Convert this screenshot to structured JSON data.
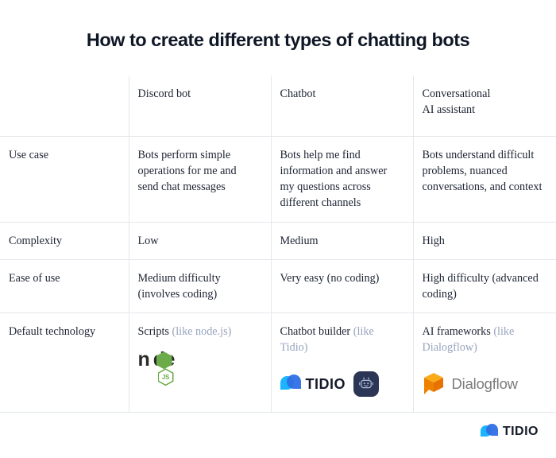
{
  "page": {
    "title": "How to create different types of chatting bots"
  },
  "table": {
    "headers": [
      "",
      "Discord bot",
      "Chatbot",
      "Conversational\nAI assistant"
    ],
    "header_col3_line1": "Conversational",
    "header_col3_line2": "AI assistant",
    "rows": [
      {
        "label": "Use case",
        "cells": [
          "Bots perform simple operations for me and send chat messages",
          "Bots help me find information and answer my questions across different channels",
          "Bots understand difficult problems, nuanced conversations, and context"
        ]
      },
      {
        "label": "Complexity",
        "cells": [
          "Low",
          "Medium",
          "High"
        ]
      },
      {
        "label": "Ease of use",
        "cells": [
          "Medium difficulty (involves coding)",
          "Very easy (no coding)",
          "High difficulty (advanced coding)"
        ]
      },
      {
        "label": "Default technology",
        "cells": [
          {
            "main": "Scripts ",
            "muted": "(like node.js)"
          },
          {
            "main": "Chatbot builder ",
            "muted": "(like Tidio)"
          },
          {
            "main": "AI frameworks ",
            "muted": "(like Dialogflow)"
          }
        ]
      }
    ]
  },
  "logos": {
    "node": {
      "wordmark": "n de",
      "badge_text": "JS",
      "name": "node.js"
    },
    "tidio": {
      "wordmark": "TIDIO",
      "name": "Tidio"
    },
    "robot": {
      "name": "chatbot-robot"
    },
    "dialogflow": {
      "wordmark": "Dialogflow",
      "name": "Dialogflow"
    }
  },
  "footer": {
    "brand": "TIDIO"
  },
  "colors": {
    "title": "#0f1726",
    "text": "#1d2433",
    "muted": "#97a3bd",
    "border": "#e4e7ec",
    "node_green": "#6cab4a",
    "tidio_blue": "#2f6fe4",
    "tidio_cyan": "#1ab4ff",
    "dialogflow_orange": "#ef8100",
    "robot_navy": "#2b3654"
  }
}
